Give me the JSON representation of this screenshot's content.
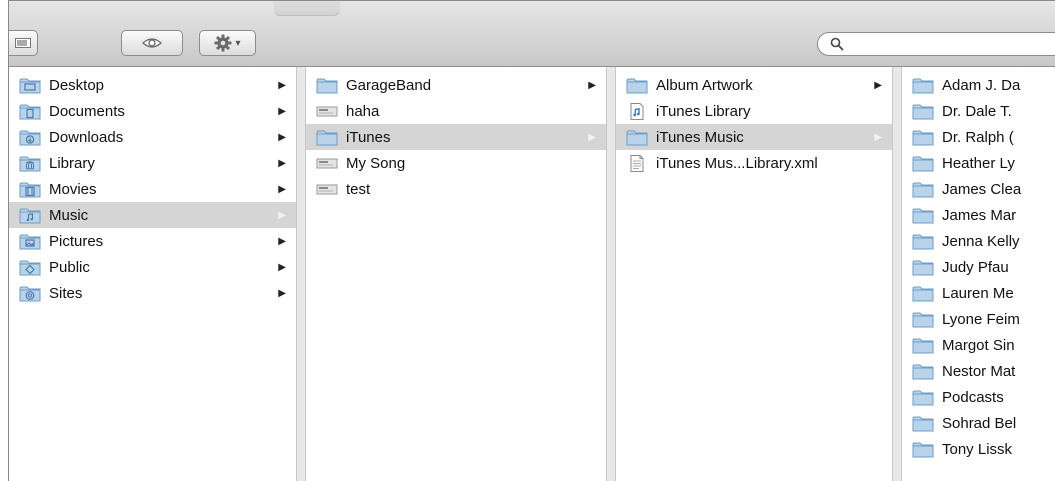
{
  "window": {
    "search": {
      "value": "",
      "placeholder": ""
    }
  },
  "toolbar": {
    "view_icon": "column-view-icon",
    "quicklook_icon": "eye-icon",
    "action_icon": "gear-icon",
    "action_arrow": "▾"
  },
  "columns": [
    {
      "items": [
        {
          "label": "Desktop",
          "icon": "desktop-folder-icon",
          "arrow": "▶",
          "selected": false
        },
        {
          "label": "Documents",
          "icon": "documents-folder-icon",
          "arrow": "▶",
          "selected": false
        },
        {
          "label": "Downloads",
          "icon": "downloads-folder-icon",
          "arrow": "▶",
          "selected": false
        },
        {
          "label": "Library",
          "icon": "library-folder-icon",
          "arrow": "▶",
          "selected": false
        },
        {
          "label": "Movies",
          "icon": "movies-folder-icon",
          "arrow": "▶",
          "selected": false
        },
        {
          "label": "Music",
          "icon": "music-folder-icon",
          "arrow": "▶",
          "selected": true
        },
        {
          "label": "Pictures",
          "icon": "pictures-folder-icon",
          "arrow": "▶",
          "selected": false
        },
        {
          "label": "Public",
          "icon": "public-folder-icon",
          "arrow": "▶",
          "selected": false
        },
        {
          "label": "Sites",
          "icon": "sites-folder-icon",
          "arrow": "▶",
          "selected": false
        }
      ]
    },
    {
      "items": [
        {
          "label": "GarageBand",
          "icon": "folder-icon",
          "arrow": "▶",
          "selected": false
        },
        {
          "label": "haha",
          "icon": "file-icon",
          "arrow": "",
          "selected": false
        },
        {
          "label": "iTunes",
          "icon": "folder-icon",
          "arrow": "▶",
          "selected": true
        },
        {
          "label": "My Song",
          "icon": "file-icon",
          "arrow": "",
          "selected": false
        },
        {
          "label": "test",
          "icon": "file-icon",
          "arrow": "",
          "selected": false
        }
      ]
    },
    {
      "items": [
        {
          "label": "Album Artwork",
          "icon": "folder-icon",
          "arrow": "▶",
          "selected": false
        },
        {
          "label": "iTunes Library",
          "icon": "music-file-icon",
          "arrow": "",
          "selected": false
        },
        {
          "label": "iTunes Music",
          "icon": "folder-icon",
          "arrow": "▶",
          "selected": true
        },
        {
          "label": "iTunes Mus...Library.xml",
          "icon": "document-icon",
          "arrow": "",
          "selected": false
        }
      ]
    },
    {
      "items": [
        {
          "label": "Adam J. Da",
          "icon": "folder-icon",
          "arrow": "",
          "selected": false
        },
        {
          "label": "Dr. Dale T.",
          "icon": "folder-icon",
          "arrow": "",
          "selected": false
        },
        {
          "label": "Dr. Ralph (",
          "icon": "folder-icon",
          "arrow": "",
          "selected": false
        },
        {
          "label": "Heather Ly",
          "icon": "folder-icon",
          "arrow": "",
          "selected": false
        },
        {
          "label": "James Clea",
          "icon": "folder-icon",
          "arrow": "",
          "selected": false
        },
        {
          "label": "James Mar",
          "icon": "folder-icon",
          "arrow": "",
          "selected": false
        },
        {
          "label": "Jenna Kelly",
          "icon": "folder-icon",
          "arrow": "",
          "selected": false
        },
        {
          "label": "Judy Pfau",
          "icon": "folder-icon",
          "arrow": "",
          "selected": false
        },
        {
          "label": "Lauren Me",
          "icon": "folder-icon",
          "arrow": "",
          "selected": false
        },
        {
          "label": "Lyone Feim",
          "icon": "folder-icon",
          "arrow": "",
          "selected": false
        },
        {
          "label": "Margot Sin",
          "icon": "folder-icon",
          "arrow": "",
          "selected": false
        },
        {
          "label": "Nestor Mat",
          "icon": "folder-icon",
          "arrow": "",
          "selected": false
        },
        {
          "label": "Podcasts",
          "icon": "folder-icon",
          "arrow": "",
          "selected": false
        },
        {
          "label": "Sohrad Bel",
          "icon": "folder-icon",
          "arrow": "",
          "selected": false
        },
        {
          "label": "Tony Lissk",
          "icon": "folder-icon",
          "arrow": "",
          "selected": false
        }
      ]
    }
  ],
  "colors": {
    "selection": "#d5d5d5",
    "folder_light": "#b9d3ea",
    "folder_dark": "#6f9cc4"
  }
}
